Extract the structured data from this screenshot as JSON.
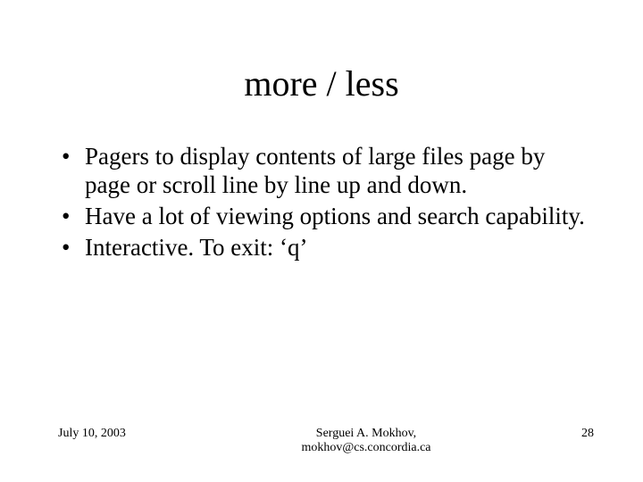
{
  "slide": {
    "title": "more / less",
    "bullets": [
      "Pagers to display contents of large files page by page or scroll line by line up and down.",
      "Have a lot of viewing options and search capability.",
      "Interactive. To exit: ‘q’"
    ],
    "footer": {
      "date": "July 10, 2003",
      "author_line1": "Serguei A. Mokhov,",
      "author_line2": "mokhov@cs.concordia.ca",
      "page": "28"
    }
  }
}
